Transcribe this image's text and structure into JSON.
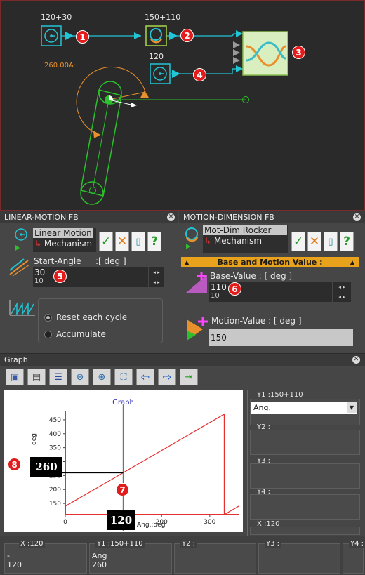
{
  "canvas": {
    "block1_label": "120+30",
    "block2_label": "150+110",
    "block3_label": "120",
    "rocker_label": "260.00A·",
    "markers": [
      "1",
      "2",
      "3",
      "4"
    ]
  },
  "linear_fb": {
    "title": "LINEAR-MOTION FB",
    "name_selected": "Linear Motion",
    "mechanism": "Mechanism",
    "start_angle_label": "Start-Angle",
    "start_angle_unit": ":[ deg ]",
    "start_angle_value": "30",
    "start_angle_step": "10",
    "marker": "5",
    "options": [
      "Reset each cycle",
      "Accumulate"
    ]
  },
  "dimension_fb": {
    "title": "MOTION-DIMENSION FB",
    "name_selected": "Mot-Dim Rocker",
    "mechanism": "Mechanism",
    "section_bar": "Base and Motion Value :",
    "base_value_label": "Base-Value : [ deg ]",
    "base_value": "110",
    "base_step": "10",
    "marker": "6",
    "motion_value_label": "Motion-Value : [ deg ]",
    "motion_value": "150"
  },
  "graph": {
    "title": "Graph",
    "plot_title": "Graph",
    "y_unit": "deg",
    "x_unit": "Ang.:deg",
    "y_readout": "260",
    "x_readout": "120",
    "marker_y": "8",
    "marker_x": "7",
    "y1_label": "Y1 :150+110",
    "y1_select": "Ang.",
    "y2_label": "Y2 :",
    "y3_label": "Y3 :",
    "y4_label": "Y4 :",
    "x_label": "X :120",
    "bottom": {
      "x_head": "X :120",
      "x_line1": "-",
      "x_line2": "120",
      "y1_head": "Y1 :150+110",
      "y1_line1": "Ang",
      "y1_line2": "260",
      "y2_head": "Y2 :",
      "y3_head": "Y3 :",
      "y4_head": "Y4 :"
    }
  },
  "colors": {
    "cyan": "#22c5d6",
    "green": "#2cc02c",
    "orange": "#e8902c",
    "red": "#e41b1b",
    "plot_line": "#e53030"
  },
  "chart_data": {
    "type": "line",
    "title": "Graph",
    "xlabel": "Ang.:deg",
    "ylabel": "deg",
    "xlim": [
      0,
      360
    ],
    "ylim": [
      110,
      480
    ],
    "x_ticks": [
      0,
      100,
      200,
      300
    ],
    "y_ticks": [
      150,
      200,
      250,
      300,
      350,
      400,
      450
    ],
    "series": [
      {
        "x": [
          0,
          330,
          330,
          360
        ],
        "y": [
          140,
          470,
          110,
          140
        ]
      }
    ],
    "cursor": {
      "x": 120,
      "y": 260
    }
  }
}
